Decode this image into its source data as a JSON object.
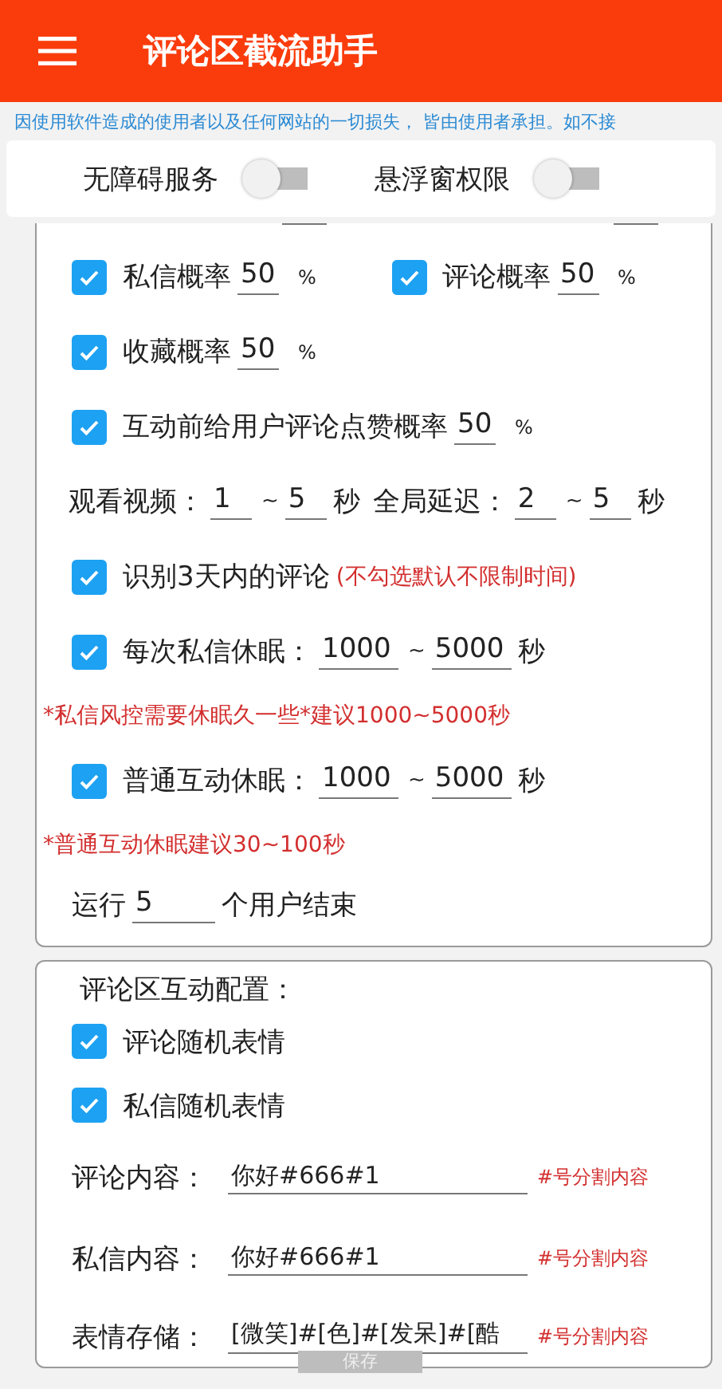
{
  "header": {
    "title": "评论区截流助手"
  },
  "notice": "因使用软件造成的使用者以及任何网站的一切损失， 皆由使用者承担。如不接",
  "permissions": [
    {
      "label": "无障碍服务",
      "on": false
    },
    {
      "label": "悬浮窗权限",
      "on": false
    }
  ],
  "settings": [
    {
      "kind": "checks",
      "items": [
        {
          "label": "私信概率",
          "checked": true,
          "value": "50",
          "unit": "%"
        },
        {
          "label": "评论概率",
          "checked": true,
          "value": "50",
          "unit": "%"
        }
      ]
    },
    {
      "kind": "checks",
      "items": [
        {
          "label": "收藏概率",
          "checked": true,
          "value": "50",
          "unit": "%"
        }
      ]
    },
    {
      "kind": "checks",
      "items": [
        {
          "label": "互动前给用户评论点赞概率",
          "checked": true,
          "value": "50",
          "unit": "%"
        }
      ]
    },
    {
      "kind": "ranges",
      "items": [
        {
          "label": "观看视频：",
          "from": "1",
          "sep": "~",
          "to": "5",
          "unit": "秒"
        },
        {
          "label": "全局延迟：",
          "from": "2",
          "sep": "~",
          "to": "5",
          "unit": "秒"
        }
      ]
    },
    {
      "kind": "check_note",
      "label": "识别3天内的评论",
      "checked": true,
      "note": "(不勾选默认不限制时间)"
    },
    {
      "kind": "check_range",
      "label": "每次私信休眠：",
      "checked": true,
      "from": "1000",
      "sep": "~",
      "to": "5000",
      "unit": "秒"
    },
    {
      "kind": "hint",
      "text": "*私信风控需要休眠久一些*建议1000~5000秒"
    },
    {
      "kind": "check_range",
      "label": "普通互动休眠：",
      "checked": true,
      "from": "1000",
      "sep": "~",
      "to": "5000",
      "unit": "秒"
    },
    {
      "kind": "hint",
      "text": "*普通互动休眠建议30~100秒"
    },
    {
      "kind": "run",
      "prefix": "运行",
      "value": "5",
      "suffix": "个用户结束"
    }
  ],
  "interaction": {
    "title": "评论区互动配置：",
    "options": [
      {
        "label": "评论随机表情",
        "checked": true
      },
      {
        "label": "私信随机表情",
        "checked": true
      }
    ],
    "fields": [
      {
        "label": "评论内容：",
        "value": "你好#666#1",
        "hint": "#号分割内容"
      },
      {
        "label": "私信内容：",
        "value": "你好#666#1",
        "hint": "#号分割内容"
      },
      {
        "label": "表情存储：",
        "value": "[微笑]#[色]#[发呆]#[酷",
        "hint": "#号分割内容"
      }
    ]
  },
  "save_button": "保存"
}
